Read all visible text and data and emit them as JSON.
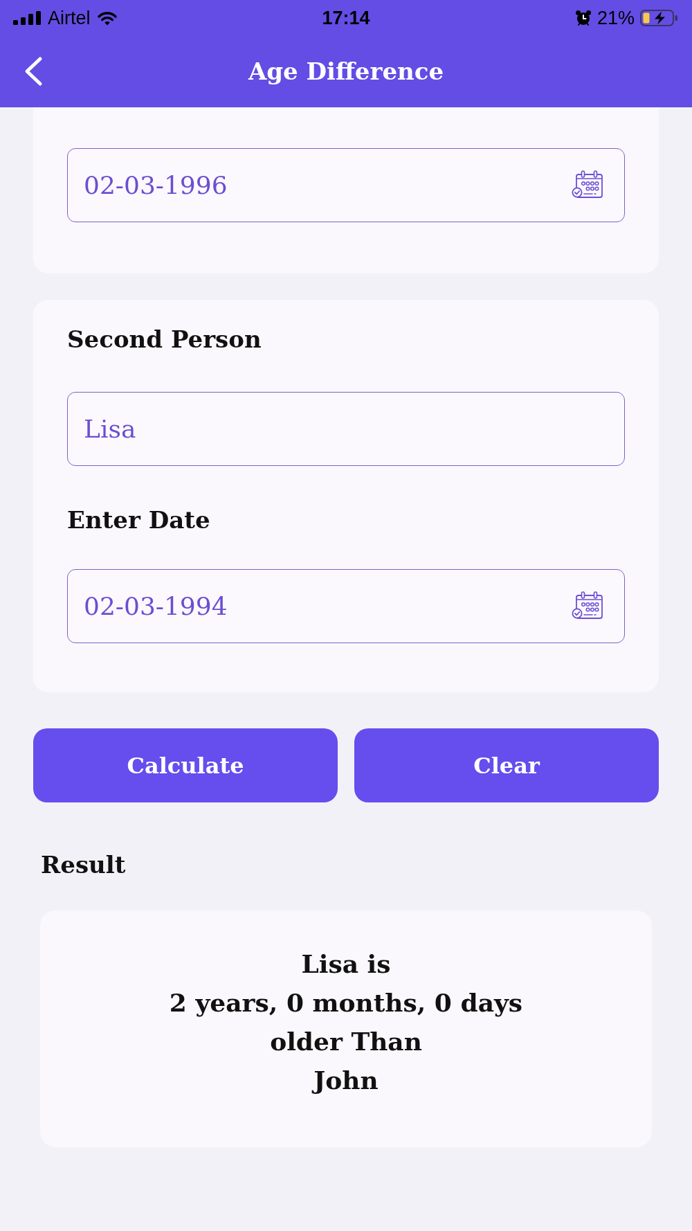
{
  "status_bar": {
    "carrier": "Airtel",
    "time": "17:14",
    "battery": "21%"
  },
  "header": {
    "title": "Age Difference"
  },
  "cards": [
    {
      "items": [
        {
          "kind": "date_field",
          "value": "02-03-1996"
        }
      ]
    },
    {
      "items": [
        {
          "kind": "heading",
          "text": "Second Person"
        },
        {
          "kind": "text_field",
          "value": "Lisa"
        },
        {
          "kind": "label",
          "text": "Enter Date"
        },
        {
          "kind": "date_field",
          "value": "02-03-1994"
        }
      ]
    }
  ],
  "buttons": [
    {
      "label": "Calculate"
    },
    {
      "label": "Clear"
    }
  ],
  "result": {
    "title": "Result",
    "text": "Lisa is\n2 years, 0 months, 0 days\nolder Than\nJohn"
  }
}
